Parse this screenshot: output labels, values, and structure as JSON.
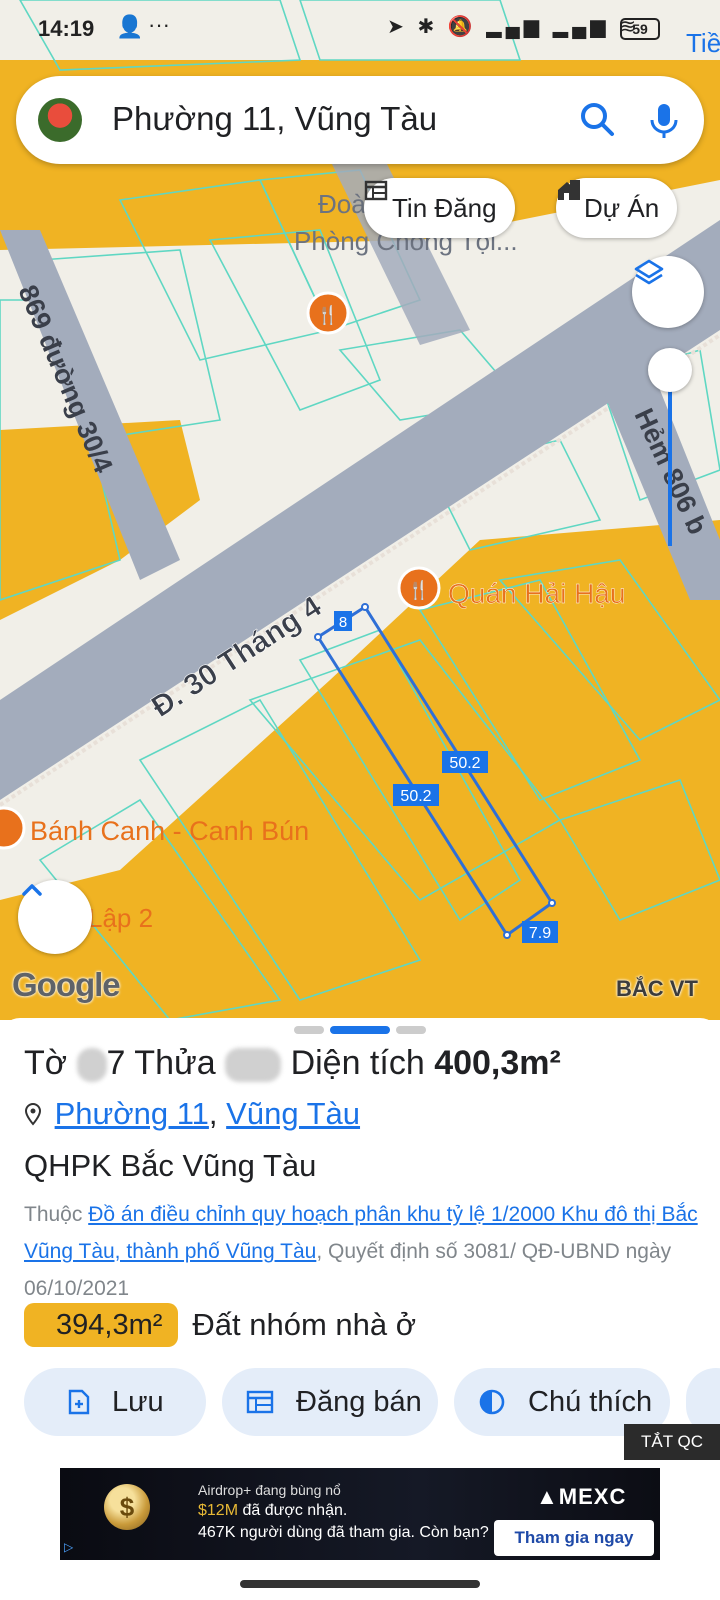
{
  "status_bar": {
    "time": "14:19",
    "battery": "59"
  },
  "search": {
    "query": "Phường 11, Vũng Tàu"
  },
  "chips": {
    "listings": "Tin Đăng",
    "projects": "Dự Án"
  },
  "map": {
    "labels": {
      "road_main": "Đ. 30 Tháng 4",
      "road_left": "869 đường 30/4",
      "road_right": "Hẻm 806 b",
      "poi_1": "Quán Hải Hậu",
      "poi_2": "Bánh Canh - Canh Bún",
      "poi_3_partial": "Đoà",
      "poi_4_partial": "Phòng Chống Tội...",
      "poi_5_partial": "Lập 2",
      "corner_partial": "Tiề"
    },
    "parcel_dims": {
      "front": "8",
      "left": "50.2",
      "right": "50.2",
      "back": "7.9"
    },
    "attribution": "Google",
    "region_tag": "BẮC VT"
  },
  "sheet": {
    "title_prefix": "Tờ",
    "title_sheet_tail": "7",
    "title_parcel": "Thửa",
    "title_area_label": "Diện tích",
    "title_area_value": "400,3m²",
    "ward_link": "Phường 11",
    "separator": ",",
    "city_link": "Vũng Tàu",
    "plan_name": "QHPK Bắc Vũng Tàu",
    "plan_desc_prefix": "Thuộc",
    "plan_desc_link": "Đồ án điều chỉnh quy hoạch phân khu tỷ lệ 1/2000 Khu đô thị Bắc Vũng Tàu, thành phố Vũng Tàu",
    "plan_desc_suffix": ", Quyết định số 3081/ QĐ-UBND ngày 06/10/2021",
    "zone_area": "394,3m²",
    "zone_type": "Đất nhóm nhà ở"
  },
  "actions": {
    "save": "Lưu",
    "post": "Đăng bán",
    "legend": "Chú thích"
  },
  "ad": {
    "hide_label": "TẮT QC",
    "line1": "Airdrop+ đang bùng nổ",
    "line2_amount": "$12M",
    "line2_rest": " đã được nhận.",
    "line3": "467K người dùng đã tham gia. Còn bạn?",
    "brand": "MEXC",
    "cta": "Tham gia ngay"
  },
  "colors": {
    "accent": "#1a73e8",
    "zone": "#f0b323",
    "road": "#a3acbc",
    "parcel_line": "#2f6fd6",
    "poi": "#e8711c"
  }
}
